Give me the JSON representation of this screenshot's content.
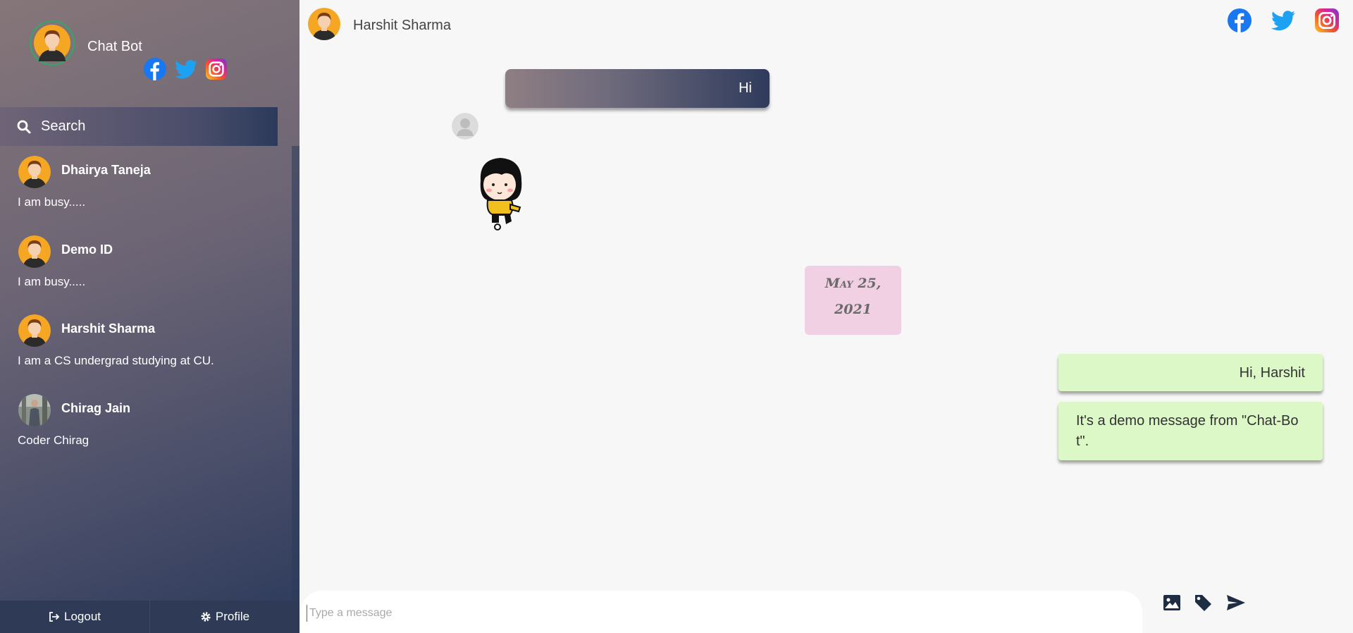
{
  "app": {
    "title": "Chat Bot",
    "socials": [
      "facebook-icon",
      "twitter-icon",
      "instagram-icon"
    ]
  },
  "search": {
    "label": "Search"
  },
  "contacts": [
    {
      "name": "Dhairya Taneja",
      "status": "I am busy.....",
      "avatar": "avatar-icon"
    },
    {
      "name": "Demo ID",
      "status": "I am busy.....",
      "avatar": "avatar-icon"
    },
    {
      "name": "Harshit Sharma",
      "status": "I am a CS undergrad studying at CU.",
      "avatar": "avatar-icon"
    },
    {
      "name": "Chirag Jain",
      "status": "Coder Chirag",
      "avatar": "photo-avatar"
    }
  ],
  "footer": {
    "logout": "Logout",
    "profile": "Profile"
  },
  "chat": {
    "partner_name": "Harshit Sharma",
    "messages": {
      "received_text": "Hi",
      "date_line1": "May 25,",
      "date_line2": "2021",
      "sent_1": "Hi, Harshit",
      "sent_2": "It's a demo message from \"Chat-Bot\"."
    }
  },
  "composer": {
    "placeholder": "Type a message"
  },
  "colors": {
    "sent_bubble": "#dcf8c6",
    "date_chip": "#f0d0e2",
    "sidebar_dark": "#2c3a5b",
    "facebook": "#1877f2",
    "twitter": "#1da1f2"
  }
}
